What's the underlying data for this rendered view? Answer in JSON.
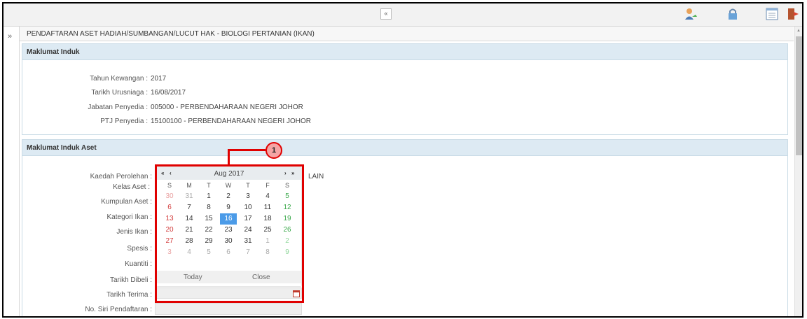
{
  "topbar": {
    "collapse_glyph": "«",
    "icons": [
      "user-icon",
      "lock-icon",
      "list-icon",
      "logout-icon"
    ]
  },
  "sidebar": {
    "expand_glyph": "»"
  },
  "page": {
    "title": "PENDAFTARAN ASET HADIAH/SUMBANGAN/LUCUT HAK - BIOLOGI PERTANIAN (IKAN)"
  },
  "induk": {
    "heading": "Maklumat Induk",
    "fields": [
      {
        "label": "Tahun Kewangan :",
        "value": "2017"
      },
      {
        "label": "Tarikh Urusniaga :",
        "value": "16/08/2017"
      },
      {
        "label": "Jabatan Penyedia :",
        "value": "005000 - PERBENDAHARAAN NEGERI JOHOR"
      },
      {
        "label": "PTJ Penyedia :",
        "value": "15100100 - PERBENDAHARAAN NEGERI JOHOR"
      }
    ]
  },
  "aset": {
    "heading": "Maklumat Induk Aset",
    "fields": [
      {
        "label": "Kaedah Perolehan :",
        "value": "LAIN"
      },
      {
        "label": "Kelas Aset :"
      },
      {
        "label": "Kumpulan Aset :"
      },
      {
        "label": "Kategori Ikan :"
      },
      {
        "label": "Jenis Ikan :"
      },
      {
        "label": "Spesis :"
      },
      {
        "label": "Kuantiti :"
      },
      {
        "label": "Tarikh Dibeli :"
      },
      {
        "label": "Tarikh Terima :"
      },
      {
        "label": "No. Siri Pendaftaran :"
      }
    ]
  },
  "calendar": {
    "month": "Aug 2017",
    "weekdays": [
      "S",
      "M",
      "T",
      "W",
      "T",
      "F",
      "S"
    ],
    "weeks": [
      [
        "30",
        "31",
        "1",
        "2",
        "3",
        "4",
        "5"
      ],
      [
        "6",
        "7",
        "8",
        "9",
        "10",
        "11",
        "12"
      ],
      [
        "13",
        "14",
        "15",
        "16",
        "17",
        "18",
        "19"
      ],
      [
        "20",
        "21",
        "22",
        "23",
        "24",
        "25",
        "26"
      ],
      [
        "27",
        "28",
        "29",
        "30",
        "31",
        "1",
        "2"
      ],
      [
        "3",
        "4",
        "5",
        "6",
        "7",
        "8",
        "9"
      ]
    ],
    "selected": "16",
    "today_label": "Today",
    "close_label": "Close",
    "nav_prev_year": "«",
    "nav_prev_month": "‹",
    "nav_next_month": "›",
    "nav_next_year": "»"
  },
  "callout": {
    "label": "1"
  },
  "colors": {
    "highlight": "#e00000",
    "selected": "#4b9be8",
    "panel_head": "#ddeaf3"
  }
}
